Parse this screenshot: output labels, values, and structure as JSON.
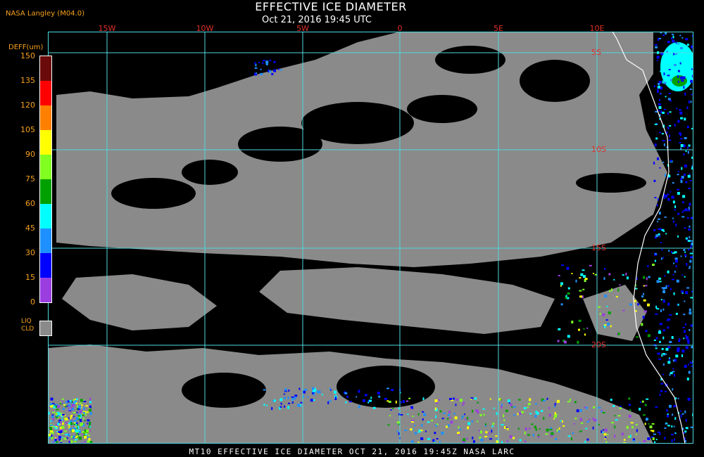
{
  "header": {
    "credit": "NASA Langley (M04.0)",
    "title": "EFFECTIVE ICE DIAMETER",
    "subtitle": "Oct 21, 2016 19:45 UTC"
  },
  "footer": {
    "caption": "MT10   EFFECTIVE ICE DIAMETER   OCT 21, 2016 19:45Z   NASA LARC"
  },
  "legend": {
    "title": "DEFF(um)",
    "ticks": [
      "150",
      "135",
      "120",
      "105",
      "90",
      "75",
      "60",
      "45",
      "30",
      "15",
      "0"
    ],
    "colors": [
      "#6b0a0a",
      "#ff0000",
      "#ff7f00",
      "#ffff00",
      "#80ff20",
      "#00a000",
      "#00ffff",
      "#1e90ff",
      "#0000ff",
      "#9a3ee0"
    ],
    "liquid_label_1": "LIQ",
    "liquid_label_2": "CLD",
    "liquid_color": "#8a8a8a"
  },
  "map": {
    "lon_labels": [
      "15W",
      "10W",
      "5W",
      "0",
      "5E",
      "10E"
    ],
    "lat_labels": [
      "5S",
      "10S",
      "15S",
      "20S"
    ],
    "grid_color": "#4fd8e0",
    "coast_color": "#ffffff",
    "cloud_color": "#8a8a8a"
  }
}
